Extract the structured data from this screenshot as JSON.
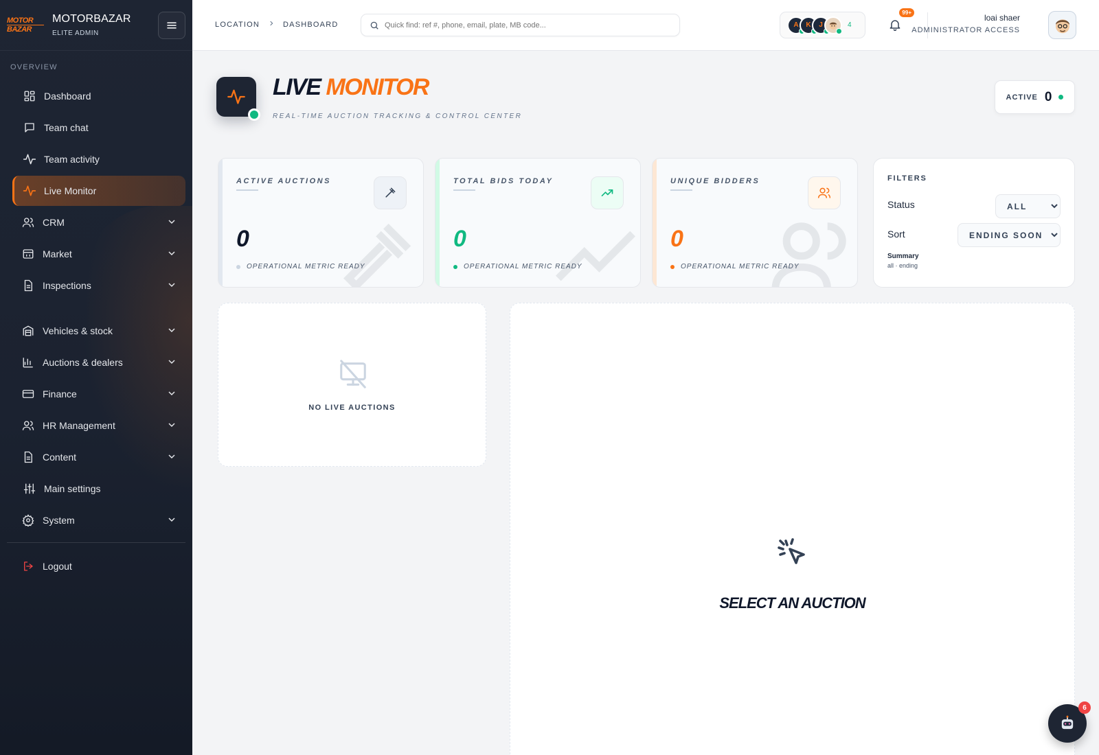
{
  "brand": {
    "logo_top": "MOTOR",
    "logo_bottom": "BAZAR",
    "name": "MOTORBAZAR",
    "subtitle": "ELITE ADMIN"
  },
  "sidebar": {
    "section_label": "OVERVIEW",
    "items": [
      {
        "label": "Dashboard",
        "icon": "dashboard-icon"
      },
      {
        "label": "Team chat",
        "icon": "chat-icon"
      },
      {
        "label": "Team activity",
        "icon": "activity-icon"
      },
      {
        "label": "Live Monitor",
        "icon": "pulse-icon",
        "active": true
      },
      {
        "label": "CRM",
        "icon": "users-icon",
        "expandable": true
      },
      {
        "label": "Market",
        "icon": "store-icon",
        "expandable": true
      },
      {
        "label": "Inspections",
        "icon": "document-icon",
        "expandable": true
      },
      {
        "label": "Vehicles & stock",
        "icon": "warehouse-icon",
        "expandable": true
      },
      {
        "label": "Auctions & dealers",
        "icon": "bar-chart-icon",
        "expandable": true
      },
      {
        "label": "Finance",
        "icon": "credit-card-icon",
        "expandable": true
      },
      {
        "label": "HR Management",
        "icon": "users-icon",
        "expandable": true
      },
      {
        "label": "Content",
        "icon": "document-icon",
        "expandable": true
      },
      {
        "label": "Main settings",
        "icon": "sliders-icon"
      },
      {
        "label": "System",
        "icon": "gear-icon",
        "expandable": true
      }
    ],
    "logout_label": "Logout"
  },
  "topbar": {
    "breadcrumb": [
      "LOCATION",
      "DASHBOARD"
    ],
    "search_placeholder": "Quick find: ref #, phone, email, plate, MB code...",
    "presence": {
      "avatars": [
        "A",
        "K",
        "J"
      ],
      "count": "4"
    },
    "notifications_badge": "99+",
    "user_name": "loai shaer",
    "user_role": "ADMINISTRATOR ACCESS"
  },
  "header": {
    "title_part1": "LIVE",
    "title_part2": "MONITOR",
    "subtitle": "REAL-TIME AUCTION TRACKING & CONTROL CENTER",
    "active_label": "ACTIVE",
    "active_count": "0"
  },
  "stats": [
    {
      "label": "ACTIVE AUCTIONS",
      "value": "0",
      "status": "OPERATIONAL METRIC READY",
      "icon": "gavel-icon",
      "color": "#0f172a"
    },
    {
      "label": "TOTAL BIDS TODAY",
      "value": "0",
      "status": "OPERATIONAL METRIC READY",
      "icon": "trending-up-icon",
      "color": "#10b981"
    },
    {
      "label": "UNIQUE BIDDERS",
      "value": "0",
      "status": "OPERATIONAL METRIC READY",
      "icon": "users-icon",
      "color": "#f97316"
    }
  ],
  "filters": {
    "title": "FILTERS",
    "status_label": "Status",
    "status_value": "ALL",
    "sort_label": "Sort",
    "sort_value": "ENDING SOON",
    "summary_title": "Summary",
    "summary_value": "all · ending"
  },
  "list_panel": {
    "empty_text": "NO LIVE AUCTIONS"
  },
  "detail_panel": {
    "empty_text": "SELECT AN AUCTION"
  },
  "bot": {
    "badge": "6"
  },
  "colors": {
    "accent": "#f97316",
    "success": "#10b981",
    "sidebar_bg": "#1e2533",
    "danger": "#ef4444"
  }
}
